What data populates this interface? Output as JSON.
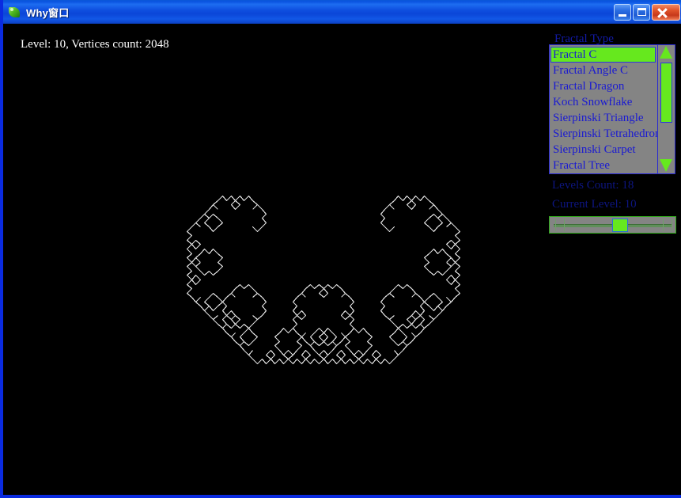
{
  "window": {
    "title": "Why窗口",
    "icon": "leaf-app-icon",
    "controls": {
      "minimize": "–",
      "maximize": "□",
      "close": "✕"
    }
  },
  "canvas": {
    "status_text": "Level: 10, Vertices count: 2048",
    "background_color": "#000000",
    "stroke_color": "#d8d8d8"
  },
  "panel": {
    "fractal_type_label": "Fractal Type",
    "fractal_types": [
      {
        "label": "Fractal C",
        "selected": true
      },
      {
        "label": "Fractal Angle C",
        "selected": false
      },
      {
        "label": "Fractal Dragon",
        "selected": false
      },
      {
        "label": "Koch Snowflake",
        "selected": false
      },
      {
        "label": "Sierpinski Triangle",
        "selected": false
      },
      {
        "label": "Sierpinski Tetrahedron",
        "selected": false
      },
      {
        "label": "Sierpinski Carpet",
        "selected": false
      },
      {
        "label": "Fractal Tree",
        "selected": false
      }
    ],
    "scrollbar": {
      "up_arrow": "▲",
      "down_arrow": "▼"
    },
    "levels_count_label": "Levels Count: 18",
    "current_level_label": "Current Level: 10",
    "slider": {
      "value": 10,
      "min": 0,
      "max": 18,
      "percent": 56
    }
  },
  "colors": {
    "title_bar_blue": "#0f4fe0",
    "frame_blue": "#0a2be0",
    "panel_gray": "#848484",
    "accent_green": "#66e81e",
    "list_text_blue": "#1a1ad2",
    "label_blue": "#121aa8",
    "close_red": "#c6381a"
  }
}
